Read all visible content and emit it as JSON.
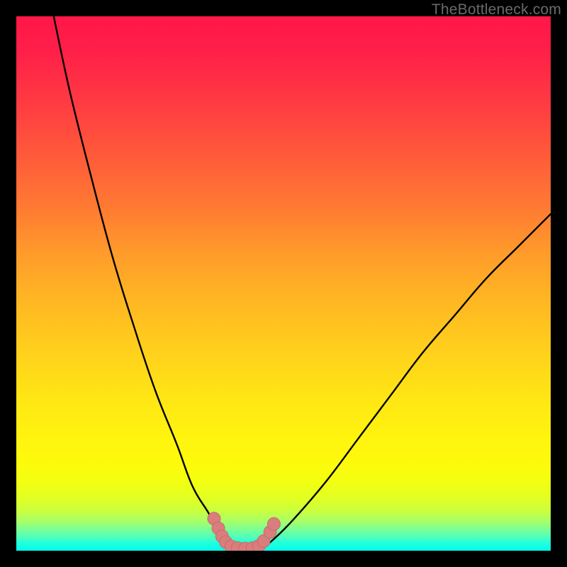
{
  "watermark": "TheBottleneck.com",
  "colors": {
    "curve": "#000000",
    "marker_fill": "#d97e7d",
    "marker_stroke": "#c96a69",
    "frame": "#000000"
  },
  "chart_data": {
    "type": "line",
    "title": "",
    "xlabel": "",
    "ylabel": "",
    "xlim": [
      0,
      100
    ],
    "ylim": [
      0,
      100
    ],
    "grid": false,
    "legend": false,
    "background": "rainbow-vertical-gradient",
    "series": [
      {
        "name": "left-branch",
        "x": [
          7,
          10,
          14,
          18,
          22,
          26,
          30,
          33,
          36,
          38,
          39,
          40
        ],
        "y": [
          100,
          86,
          70,
          55,
          42,
          30,
          20,
          12,
          7,
          3,
          1.5,
          0.5
        ]
      },
      {
        "name": "valley",
        "x": [
          40,
          41,
          42,
          43,
          44,
          45,
          46
        ],
        "y": [
          0.5,
          0.2,
          0.1,
          0.1,
          0.1,
          0.2,
          0.5
        ]
      },
      {
        "name": "right-branch",
        "x": [
          46,
          48,
          52,
          58,
          64,
          70,
          76,
          82,
          88,
          94,
          100
        ],
        "y": [
          0.5,
          2,
          6,
          13,
          21,
          29,
          37,
          44,
          51,
          57,
          63
        ]
      }
    ],
    "markers": [
      {
        "x": 37.0,
        "y": 6.0
      },
      {
        "x": 37.8,
        "y": 4.2
      },
      {
        "x": 38.5,
        "y": 2.7
      },
      {
        "x": 39.2,
        "y": 1.6
      },
      {
        "x": 40.2,
        "y": 0.8
      },
      {
        "x": 41.4,
        "y": 0.5
      },
      {
        "x": 42.8,
        "y": 0.4
      },
      {
        "x": 44.2,
        "y": 0.5
      },
      {
        "x": 45.4,
        "y": 0.9
      },
      {
        "x": 46.3,
        "y": 1.8
      },
      {
        "x": 47.5,
        "y": 3.5
      },
      {
        "x": 48.2,
        "y": 5.0
      }
    ]
  }
}
